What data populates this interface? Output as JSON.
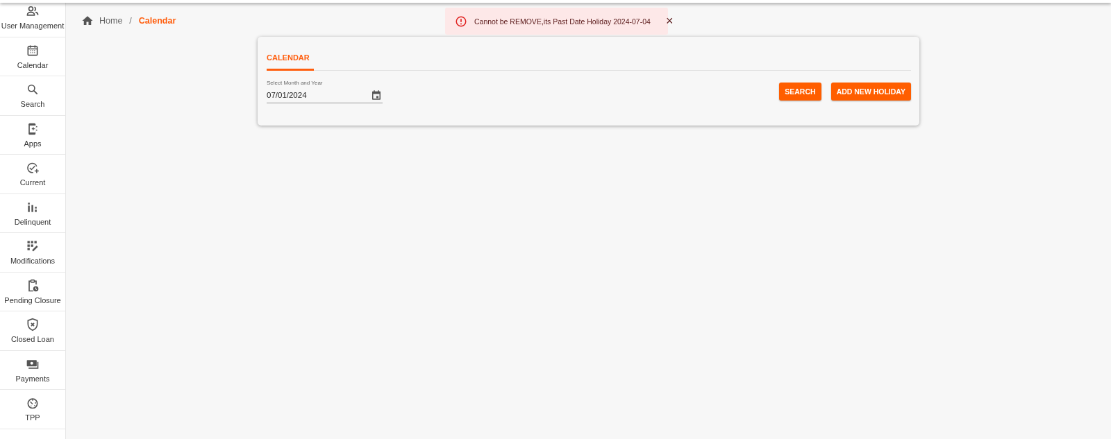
{
  "sidebar": {
    "items": [
      {
        "label": "User Management"
      },
      {
        "label": "Calendar"
      },
      {
        "label": "Search"
      },
      {
        "label": "Apps"
      },
      {
        "label": "Current"
      },
      {
        "label": "Delinquent"
      },
      {
        "label": "Modifications"
      },
      {
        "label": "Pending Closure"
      },
      {
        "label": "Closed Loan"
      },
      {
        "label": "Payments"
      },
      {
        "label": "TPP"
      }
    ]
  },
  "breadcrumb": [
    {
      "label": "Home",
      "current": false
    },
    {
      "label": "/",
      "kind": "separator"
    },
    {
      "label": "Calendar",
      "current": true
    }
  ],
  "toast": {
    "message": "Cannot be REMOVE,its Past Date Holiday 2024-07-04",
    "close": "×"
  },
  "card": {
    "tabs": [
      {
        "label": "CALENDAR",
        "selected": true
      }
    ],
    "field": {
      "label": "Select Month and Year",
      "value": "07/01/2024"
    },
    "buttons": [
      "SEARCH",
      "ADD NEW HOLIDAY"
    ]
  }
}
